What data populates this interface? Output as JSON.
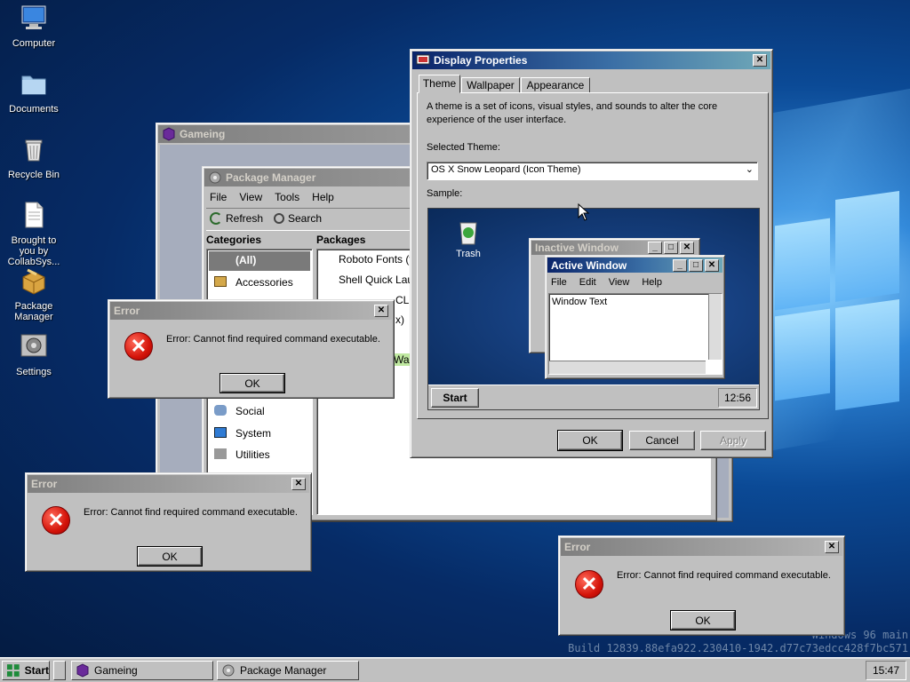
{
  "desktop": {
    "icons": [
      {
        "label": "Computer",
        "icon": "computer-icon"
      },
      {
        "label": "Documents",
        "icon": "folder-icon"
      },
      {
        "label": "Recycle Bin",
        "icon": "recycle-bin-icon"
      },
      {
        "label": "Brought to you by CollabSys...",
        "icon": "document-icon"
      },
      {
        "label": "Package Manager",
        "icon": "package-icon"
      },
      {
        "label": "Settings",
        "icon": "settings-icon"
      }
    ],
    "watermark_line1": "Windows 96 main",
    "watermark_line2": "Build 12839.88efa922.230410-1942.d77c73edcc428f7bc571"
  },
  "gameing_window": {
    "title": "Gameing"
  },
  "package_manager": {
    "title": "Package Manager",
    "menu": [
      "File",
      "View",
      "Tools",
      "Help"
    ],
    "toolbar": {
      "refresh": "Refresh",
      "search": "Search"
    },
    "categories_header": "Categories",
    "packages_header": "Packages",
    "categories": [
      "(All)",
      "Accessories",
      "Social",
      "System",
      "Utilities"
    ],
    "packages": [
      "Roboto Fonts (for",
      "Shell Quick Launc",
      "CLI",
      "x)",
      "Wall"
    ]
  },
  "display_properties": {
    "title": "Display Properties",
    "tabs": [
      "Theme",
      "Wallpaper",
      "Appearance"
    ],
    "description": "A theme is a set of icons, visual styles, and sounds to alter the core experience of the user interface.",
    "selected_theme_label": "Selected Theme:",
    "selected_theme_value": "OS X Snow Leopard (Icon Theme)",
    "sample_label": "Sample:",
    "sample": {
      "trash_label": "Trash",
      "inactive_title": "Inactive Window",
      "active_title": "Active Window",
      "menu": [
        "File",
        "Edit",
        "View",
        "Help"
      ],
      "window_text": "Window Text",
      "start_label": "Start",
      "clock": "12:56"
    },
    "buttons": {
      "ok": "OK",
      "cancel": "Cancel",
      "apply": "Apply"
    }
  },
  "error_dialogs": [
    {
      "title": "Error",
      "message": "Error: Cannot find required command executable.",
      "ok": "OK"
    },
    {
      "title": "Error",
      "message": "Error: Cannot find required command executable.",
      "ok": "OK"
    },
    {
      "title": "Error",
      "message": "Error: Cannot find required command executable.",
      "ok": "OK"
    }
  ],
  "taskbar": {
    "start_label": "Start",
    "items": [
      "Gameing",
      "Package Manager"
    ],
    "clock": "15:47"
  },
  "colors": {
    "title_active": "#0a246a",
    "title_inactive": "#808080",
    "error_red": "#d4140a"
  }
}
